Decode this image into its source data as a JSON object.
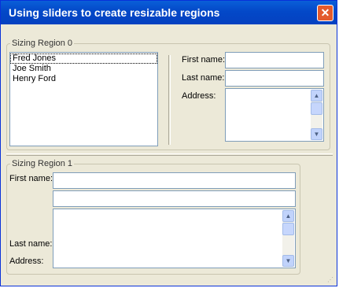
{
  "window": {
    "title": "Using sliders to create resizable regions",
    "close_glyph": "✕"
  },
  "region0": {
    "legend": "Sizing Region 0",
    "list_items": [
      "Fred Jones",
      "Joe Smith",
      "Henry Ford"
    ],
    "selected_item": "Fred Jones",
    "first_name_label": "First name:",
    "last_name_label": "Last name:",
    "address_label": "Address:",
    "first_name_value": "",
    "last_name_value": "",
    "address_value": ""
  },
  "region1": {
    "legend": "Sizing Region 1",
    "first_name_label": "First name:",
    "last_name_label": "Last name:",
    "address_label": "Address:",
    "first_name_value": "",
    "last_name_value": "",
    "address_value": ""
  },
  "icons": {
    "scroll_up": "▲",
    "scroll_down": "▼",
    "resize_grip": "⋰"
  },
  "colors": {
    "titlebar": "#0348c8",
    "window_bg": "#ece9d8",
    "close_button": "#e35a2d",
    "input_border": "#7f9db9"
  }
}
